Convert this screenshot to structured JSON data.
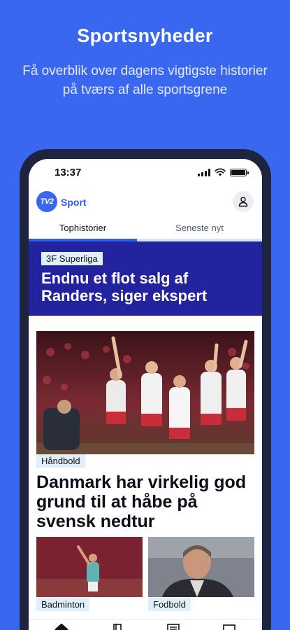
{
  "promo": {
    "title": "Sportsnyheder",
    "subtitle": "Få overblik over dagens vigtigste historier på tværs af alle sportsgrene"
  },
  "status_bar": {
    "time": "13:37",
    "icons": [
      "signal-icon",
      "wifi-icon",
      "battery-icon"
    ]
  },
  "app_bar": {
    "logo_text": "TV2",
    "brand": "Sport",
    "profile_icon": "person-icon"
  },
  "tabs": [
    {
      "label": "Tophistorier",
      "active": true
    },
    {
      "label": "Seneste nyt",
      "active": false
    }
  ],
  "hero": {
    "tag": "3F Superliga",
    "title": "Endnu et flot salg af Randers, siger ekspert"
  },
  "main_article": {
    "tag": "Håndbold",
    "title": "Danmark har virkelig god grund til at håbe på svensk nedtur"
  },
  "cards": [
    {
      "tag": "Badminton"
    },
    {
      "tag": "Fodbold"
    }
  ],
  "bottom_nav": {
    "items": [
      "home-icon",
      "bookmark-icon",
      "list-icon",
      "tablet-icon"
    ]
  },
  "colors": {
    "background": "#3a67f0",
    "hero": "#2323a0",
    "accent": "#2f5ee6",
    "tag": "#dff0fb"
  }
}
